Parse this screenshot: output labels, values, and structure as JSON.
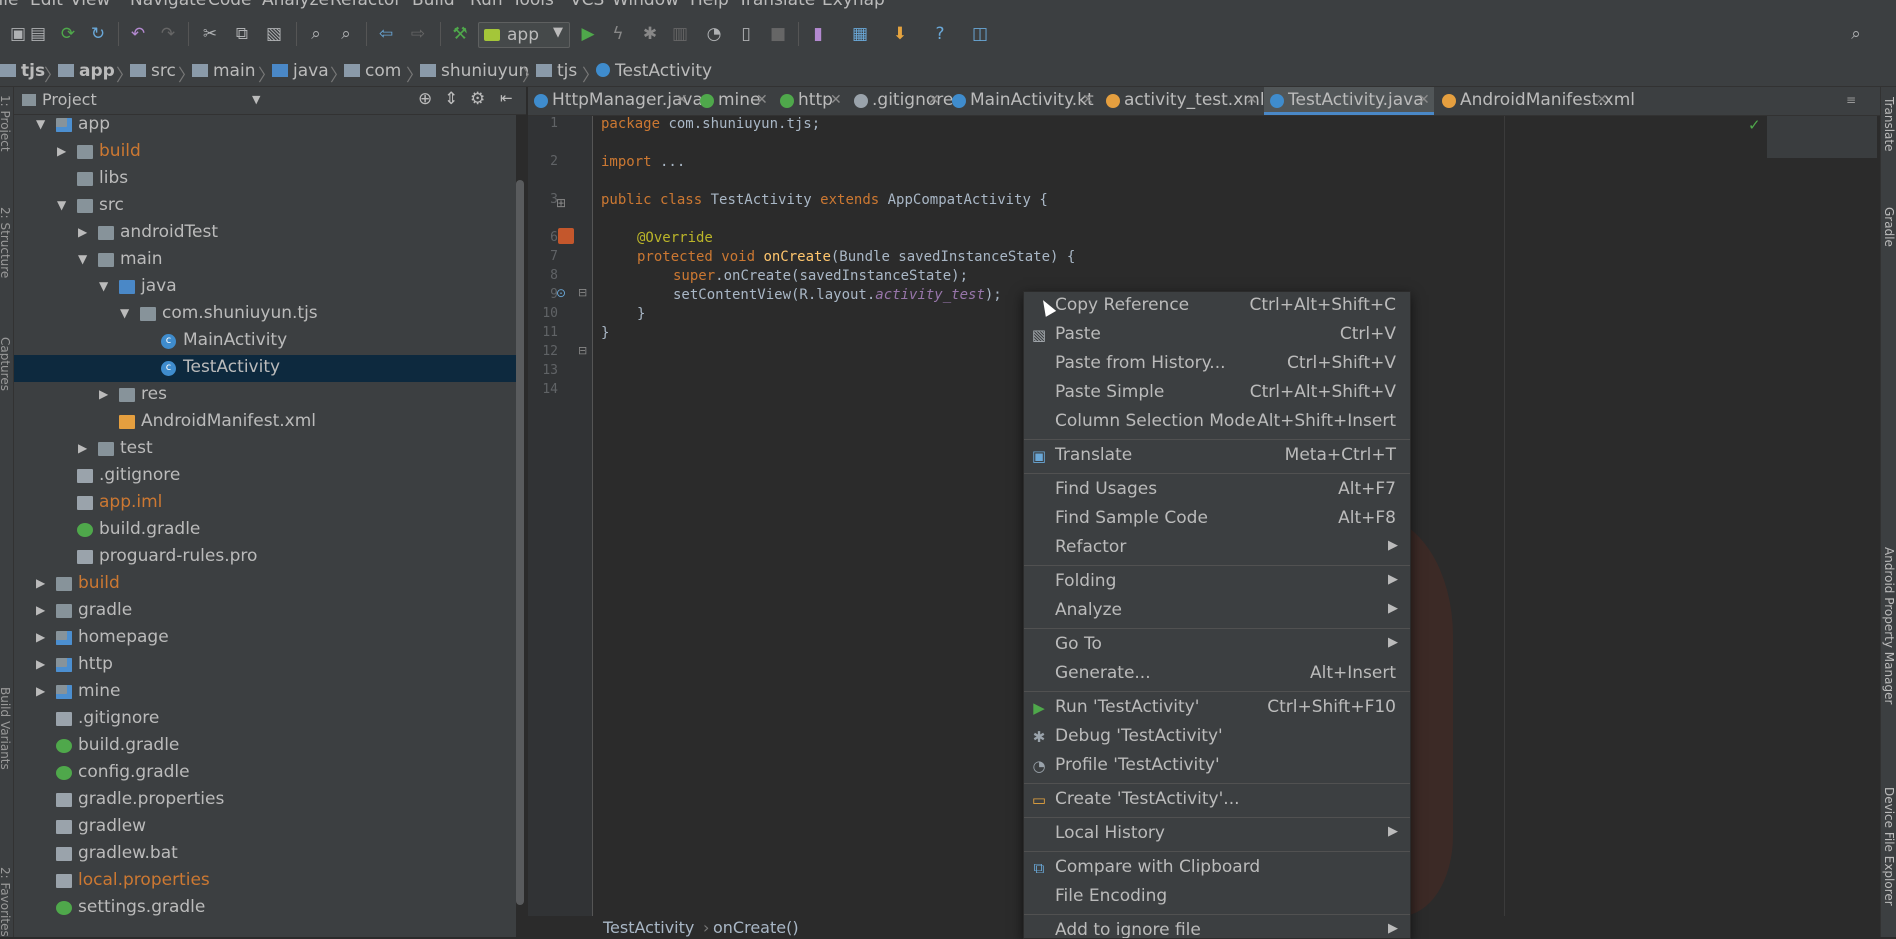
{
  "menubar": {
    "items": [
      "File",
      "Edit",
      "View",
      "Navigate",
      "Code",
      "Analyze",
      "Refactor",
      "Build",
      "Run",
      "Tools",
      "VCS",
      "Window",
      "Help",
      "Translate",
      "Exynap"
    ]
  },
  "toolbar": {
    "run_config": "app",
    "icons": [
      "open-icon",
      "save-icon",
      "sync-icon",
      "refresh-icon",
      "undo-icon",
      "redo-icon",
      "cut-icon",
      "copy-icon",
      "paste-icon",
      "find-icon",
      "replace-icon",
      "back-icon",
      "forward-icon",
      "make-icon",
      "run-icon",
      "apply-changes-icon",
      "debug-icon",
      "coverage-icon",
      "profile-icon",
      "attach-debugger-icon",
      "stop-icon",
      "avd-manager-icon",
      "project-structure-icon",
      "sdk-manager-icon",
      "help-icon",
      "layout-inspector-icon"
    ]
  },
  "breadcrumbs": [
    "tjs",
    "app",
    "src",
    "main",
    "java",
    "com",
    "shuniuyun",
    "tjs",
    "TestActivity"
  ],
  "project_panel": {
    "title": "Project",
    "left_strip_labels": [
      "1: Project",
      "2: Structure",
      "Captures",
      "Build Variants",
      "2: Favorites"
    ],
    "tree": [
      {
        "label": "app",
        "indent": 1,
        "arrow": "down",
        "icon": "folder-mod",
        "color": "#bbbbbb"
      },
      {
        "label": "build",
        "indent": 2,
        "arrow": "right",
        "icon": "folder",
        "color": "#cc7832"
      },
      {
        "label": "libs",
        "indent": 2,
        "arrow": "",
        "icon": "folder",
        "color": "#bbbbbb"
      },
      {
        "label": "src",
        "indent": 2,
        "arrow": "down",
        "icon": "folder",
        "color": "#bbbbbb"
      },
      {
        "label": "androidTest",
        "indent": 3,
        "arrow": "right",
        "icon": "folder",
        "color": "#bbbbbb"
      },
      {
        "label": "main",
        "indent": 3,
        "arrow": "down",
        "icon": "folder",
        "color": "#bbbbbb"
      },
      {
        "label": "java",
        "indent": 4,
        "arrow": "down",
        "icon": "folder-blue",
        "color": "#bbbbbb"
      },
      {
        "label": "com.shuniuyun.tjs",
        "indent": 5,
        "arrow": "down",
        "icon": "folder",
        "color": "#bbbbbb"
      },
      {
        "label": "MainActivity",
        "indent": 6,
        "arrow": "",
        "icon": "class-c",
        "color": "#bbbbbb"
      },
      {
        "label": "TestActivity",
        "indent": 6,
        "arrow": "",
        "icon": "class-c",
        "color": "#bbbbbb",
        "selected": true
      },
      {
        "label": "res",
        "indent": 4,
        "arrow": "right",
        "icon": "folder",
        "color": "#bbbbbb"
      },
      {
        "label": "AndroidManifest.xml",
        "indent": 4,
        "arrow": "",
        "icon": "file-xml",
        "color": "#bbbbbb"
      },
      {
        "label": "test",
        "indent": 3,
        "arrow": "right",
        "icon": "folder",
        "color": "#bbbbbb"
      },
      {
        "label": ".gitignore",
        "indent": 2,
        "arrow": "",
        "icon": "file-txt",
        "color": "#bbbbbb"
      },
      {
        "label": "app.iml",
        "indent": 2,
        "arrow": "",
        "icon": "file-txt",
        "color": "#cc7832"
      },
      {
        "label": "build.gradle",
        "indent": 2,
        "arrow": "",
        "icon": "file-grd",
        "color": "#bbbbbb"
      },
      {
        "label": "proguard-rules.pro",
        "indent": 2,
        "arrow": "",
        "icon": "file-txt",
        "color": "#bbbbbb"
      },
      {
        "label": "build",
        "indent": 1,
        "arrow": "right",
        "icon": "folder",
        "color": "#cc7832"
      },
      {
        "label": "gradle",
        "indent": 1,
        "arrow": "right",
        "icon": "folder",
        "color": "#bbbbbb"
      },
      {
        "label": "homepage",
        "indent": 1,
        "arrow": "right",
        "icon": "folder-mod",
        "color": "#bbbbbb"
      },
      {
        "label": "http",
        "indent": 1,
        "arrow": "right",
        "icon": "folder-mod",
        "color": "#bbbbbb"
      },
      {
        "label": "mine",
        "indent": 1,
        "arrow": "right",
        "icon": "folder-mod",
        "color": "#bbbbbb"
      },
      {
        "label": ".gitignore",
        "indent": 1,
        "arrow": "",
        "icon": "file-txt",
        "color": "#bbbbbb"
      },
      {
        "label": "build.gradle",
        "indent": 1,
        "arrow": "",
        "icon": "file-grd",
        "color": "#bbbbbb"
      },
      {
        "label": "config.gradle",
        "indent": 1,
        "arrow": "",
        "icon": "file-grd",
        "color": "#bbbbbb"
      },
      {
        "label": "gradle.properties",
        "indent": 1,
        "arrow": "",
        "icon": "file-txt",
        "color": "#bbbbbb"
      },
      {
        "label": "gradlew",
        "indent": 1,
        "arrow": "",
        "icon": "file-txt",
        "color": "#bbbbbb"
      },
      {
        "label": "gradlew.bat",
        "indent": 1,
        "arrow": "",
        "icon": "file-txt",
        "color": "#bbbbbb"
      },
      {
        "label": "local.properties",
        "indent": 1,
        "arrow": "",
        "icon": "file-txt",
        "color": "#cc7832"
      },
      {
        "label": "settings.gradle",
        "indent": 1,
        "arrow": "",
        "icon": "file-grd",
        "color": "#bbbbbb"
      }
    ]
  },
  "tabs": [
    {
      "label": "HttpManager.java",
      "icon_color": "#3f8ccd",
      "active": false
    },
    {
      "label": "mine",
      "icon_color": "#4fa84b",
      "active": false
    },
    {
      "label": "http",
      "icon_color": "#4fa84b",
      "active": false
    },
    {
      "label": ".gitignore",
      "icon_color": "#9aa3ab",
      "active": false
    },
    {
      "label": "MainActivity.kt",
      "icon_color": "#3f8ccd",
      "active": false
    },
    {
      "label": "activity_test.xml",
      "icon_color": "#e59f3f",
      "active": false
    },
    {
      "label": "TestActivity.java",
      "icon_color": "#3f8ccd",
      "active": true
    },
    {
      "label": "AndroidManifest.xml",
      "icon_color": "#e59f3f",
      "active": false
    }
  ],
  "editor": {
    "line_numbers": [
      "1",
      "2",
      "3",
      "6",
      "7",
      "8",
      "9",
      "10",
      "11",
      "12",
      "13",
      "14"
    ],
    "lines": {
      "l1_kw": "package",
      "l1_rest": " com.shuniuyun.tjs;",
      "l3_kw": "import",
      "l3_rest": " ...",
      "l6_kw1": "public class",
      "l6_name": " TestActivity ",
      "l6_kw2": "extends",
      "l6_rest": " AppCompatActivity {",
      "l8_an": "@Override",
      "l9_kw": "protected void",
      "l9_fn": " onCreate",
      "l9_rest": "(Bundle savedInstanceState) {",
      "l10_kw": "super",
      "l10_rest": ".onCreate(savedInstanceState);",
      "l11_pre": "setContentView(R.layout.",
      "l11_it": "activity_test",
      "l11_post": ");",
      "l12": "}",
      "l13": "}"
    },
    "bottom_breadcrumb": [
      "TestActivity",
      "onCreate()"
    ]
  },
  "right_strip_labels": [
    "Translate",
    "Gradle",
    "Android Property Manager",
    "Device File Explorer"
  ],
  "context_menu": {
    "items": [
      {
        "label": "Copy Reference",
        "shortcut": "Ctrl+Alt+Shift+C",
        "icon": "",
        "submenu": false
      },
      {
        "label": "Paste",
        "shortcut": "Ctrl+V",
        "icon": "paste-icon",
        "submenu": false
      },
      {
        "label": "Paste from History...",
        "shortcut": "Ctrl+Shift+V",
        "icon": "",
        "submenu": false
      },
      {
        "label": "Paste Simple",
        "shortcut": "Ctrl+Alt+Shift+V",
        "icon": "",
        "submenu": false
      },
      {
        "label": "Column Selection Mode",
        "shortcut": "Alt+Shift+Insert",
        "icon": "",
        "submenu": false
      },
      {
        "sep": true
      },
      {
        "label": "Translate",
        "shortcut": "Meta+Ctrl+T",
        "icon": "translate-icon",
        "submenu": false
      },
      {
        "sep": true
      },
      {
        "label": "Find Usages",
        "shortcut": "Alt+F7",
        "icon": "",
        "submenu": false
      },
      {
        "label": "Find Sample Code",
        "shortcut": "Alt+F8",
        "icon": "",
        "submenu": false
      },
      {
        "label": "Refactor",
        "shortcut": "",
        "icon": "",
        "submenu": true
      },
      {
        "sep": true
      },
      {
        "label": "Folding",
        "shortcut": "",
        "icon": "",
        "submenu": true
      },
      {
        "label": "Analyze",
        "shortcut": "",
        "icon": "",
        "submenu": true
      },
      {
        "sep": true
      },
      {
        "label": "Go To",
        "shortcut": "",
        "icon": "",
        "submenu": true
      },
      {
        "label": "Generate...",
        "shortcut": "Alt+Insert",
        "icon": "",
        "submenu": false
      },
      {
        "sep": true
      },
      {
        "label": "Run 'TestActivity'",
        "shortcut": "Ctrl+Shift+F10",
        "icon": "run-icon",
        "submenu": false
      },
      {
        "label": "Debug 'TestActivity'",
        "shortcut": "",
        "icon": "debug-icon",
        "submenu": false
      },
      {
        "label": "Profile 'TestActivity'",
        "shortcut": "",
        "icon": "profile-icon",
        "submenu": false
      },
      {
        "sep": true
      },
      {
        "label": "Create 'TestActivity'...",
        "shortcut": "",
        "icon": "create-config-icon",
        "submenu": false
      },
      {
        "sep": true
      },
      {
        "label": "Local History",
        "shortcut": "",
        "icon": "",
        "submenu": true
      },
      {
        "sep": true
      },
      {
        "label": "Compare with Clipboard",
        "shortcut": "",
        "icon": "compare-icon",
        "submenu": false
      },
      {
        "label": "File Encoding",
        "shortcut": "",
        "icon": "",
        "submenu": false
      },
      {
        "sep": true
      },
      {
        "label": "Add to ignore file",
        "shortcut": "",
        "icon": "",
        "submenu": true
      }
    ]
  }
}
